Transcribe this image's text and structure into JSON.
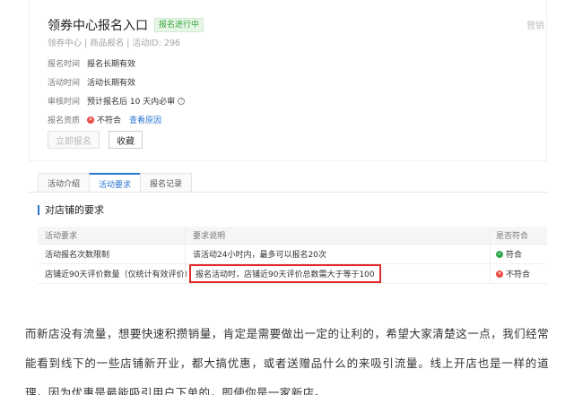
{
  "card": {
    "title": "领券中心报名入口",
    "status": "报名进行中",
    "meta": "领券中心 | 商品报名 | 活动ID: 296",
    "corner_text": "营销",
    "rows": [
      {
        "label": "报名时间",
        "value": "报名长期有效"
      },
      {
        "label": "活动时间",
        "value": "活动长期有效"
      },
      {
        "label": "审核时间",
        "value": "预计报名后 10 天内必审"
      },
      {
        "label": "报名资质",
        "value": "不符合",
        "link": "查看原因"
      }
    ],
    "buttons": {
      "signup": "立即报名",
      "favorite": "收藏"
    }
  },
  "tabs": [
    {
      "label": "活动介绍",
      "active": false
    },
    {
      "label": "活动要求",
      "active": true
    },
    {
      "label": "报名记录",
      "active": false
    }
  ],
  "section_title": "对店铺的要求",
  "table": {
    "headers": [
      "活动要求",
      "要求说明",
      "是否符合"
    ],
    "rows": [
      {
        "req": "活动报名次数限制",
        "desc": "该活动24小时内，最多可以报名20次",
        "result": "符合",
        "ok": true
      },
      {
        "req": "店铺近90天评价数量（仅统计有效评价）",
        "desc": "报名活动时，店铺近90天评价总数需大于等于100",
        "result": "不符合",
        "ok": false
      }
    ]
  },
  "article": "而新店没有流量，想要快速积攒销量，肯定是需要做出一定的让利的，希望大家清楚这一点，我们经常能看到线下的一些店铺新开业，都大搞优惠，或者送赠品什么的来吸引流量。线上开店也是一样的道理，因为优惠是最能吸引用户下单的，即使你是一家新店。",
  "colors": {
    "accent": "#2b74d1",
    "success": "#2fa84f",
    "error": "#e8473e",
    "highlight_border": "#e02a2a"
  }
}
